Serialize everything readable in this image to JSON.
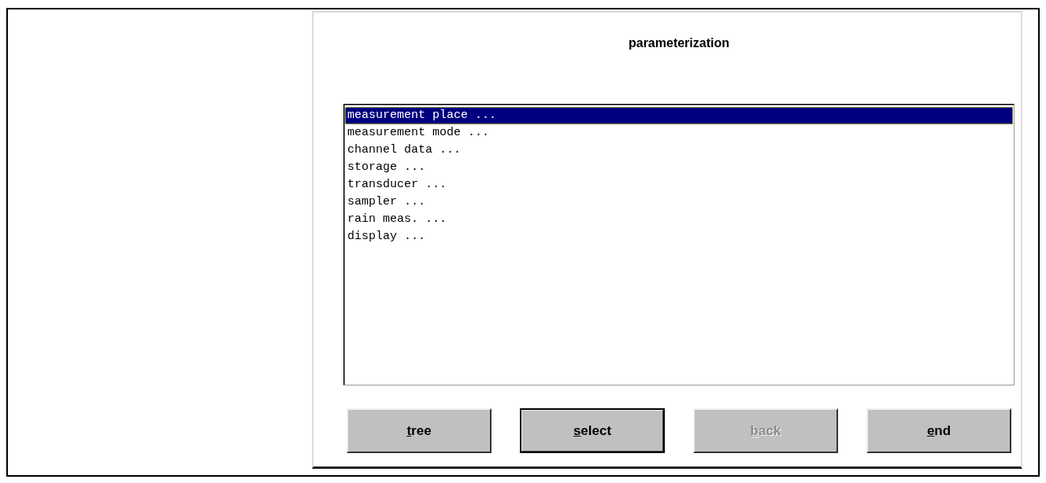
{
  "dialog": {
    "title": "parameterization"
  },
  "list": {
    "items": [
      {
        "label": "measurement place ...",
        "selected": true
      },
      {
        "label": "measurement mode ...",
        "selected": false
      },
      {
        "label": "channel data ...",
        "selected": false
      },
      {
        "label": "storage ...",
        "selected": false
      },
      {
        "label": "transducer ...",
        "selected": false
      },
      {
        "label": "sampler ...",
        "selected": false
      },
      {
        "label": "rain meas. ...",
        "selected": false
      },
      {
        "label": "display ...",
        "selected": false
      }
    ]
  },
  "buttons": [
    {
      "label": "tree",
      "default": false,
      "disabled": false
    },
    {
      "label": "select",
      "default": true,
      "disabled": false
    },
    {
      "label": "back",
      "default": false,
      "disabled": true
    },
    {
      "label": "end",
      "default": false,
      "disabled": false
    }
  ]
}
